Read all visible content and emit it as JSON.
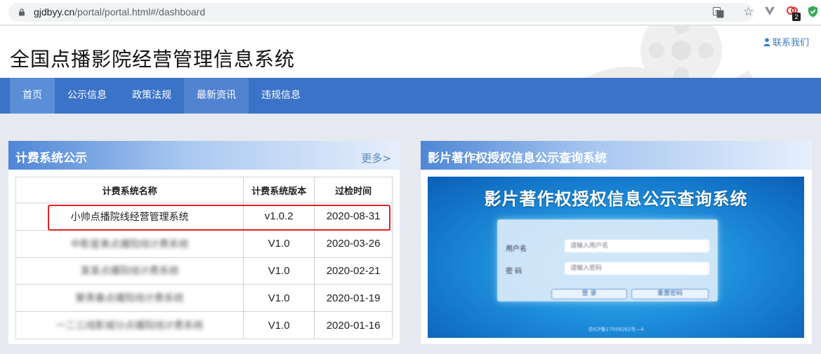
{
  "browser": {
    "url_host": "gjdbyy.cn",
    "url_path": "/portal/portal.html#/dashboard",
    "extension_badge": "2"
  },
  "header": {
    "site_title": "全国点播影院经营管理信息系统",
    "contact_label": "联系我们"
  },
  "nav": {
    "items": [
      {
        "label": "首页"
      },
      {
        "label": "公示信息"
      },
      {
        "label": "政策法规"
      },
      {
        "label": "最新资讯"
      },
      {
        "label": "违规信息"
      }
    ]
  },
  "billing_panel": {
    "title": "计费系统公示",
    "more_label": "更多>",
    "columns": [
      "计费系统名称",
      "计费系统版本",
      "过检时间"
    ],
    "rows": [
      {
        "name": "小帅点播院线经营管理系统",
        "version": "v1.0.2",
        "date": "2020-08-31"
      },
      {
        "name": "中影星美点播院线计费系统",
        "version": "V1.0",
        "date": "2020-03-26"
      },
      {
        "name": "某某点播院线计费系统",
        "version": "V1.0",
        "date": "2020-02-21"
      },
      {
        "name": "聚青春点播院线计费系统",
        "version": "V1.0",
        "date": "2020-01-19"
      },
      {
        "name": "一二三线影城分点播院线计费系统",
        "version": "V1.0",
        "date": "2020-01-16"
      }
    ]
  },
  "copyright_panel": {
    "title": "影片著作权授权信息公示查询系统",
    "banner_title": "影片著作权授权信息公示查询系统",
    "username_label": "用户名",
    "username_placeholder": "请输入用户名",
    "password_label": "密 码",
    "password_placeholder": "请输入密码",
    "login_label": "登 录",
    "reset_label": "重置密码",
    "footer_text": "京ICP备17058262号—4"
  },
  "colors": {
    "nav_bg": "#3a73c8",
    "highlight_border": "#e02020",
    "link": "#3b78c7"
  }
}
